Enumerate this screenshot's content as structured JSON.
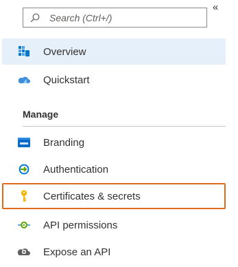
{
  "search": {
    "placeholder": "Search (Ctrl+/)",
    "icon": "search-icon"
  },
  "collapse": {
    "glyph": "«"
  },
  "top_items": [
    {
      "label": "Overview",
      "icon": "overview-grid-icon",
      "selected": true
    },
    {
      "label": "Quickstart",
      "icon": "cloud-icon"
    }
  ],
  "manage": {
    "title": "Manage",
    "items": [
      {
        "label": "Branding",
        "icon": "branding-icon"
      },
      {
        "label": "Authentication",
        "icon": "authentication-icon"
      },
      {
        "label": "Certificates & secrets",
        "icon": "key-icon",
        "focused": true
      },
      {
        "label": "API permissions",
        "icon": "api-permissions-icon"
      },
      {
        "label": "Expose an API",
        "icon": "cloud-gear-icon"
      }
    ]
  },
  "colors": {
    "selected_bg": "#e6f0fa",
    "focus_border": "#e06a1b",
    "accent_blue": "#0078d4",
    "key_yellow": "#f2b705",
    "api_green": "#5ea400"
  }
}
